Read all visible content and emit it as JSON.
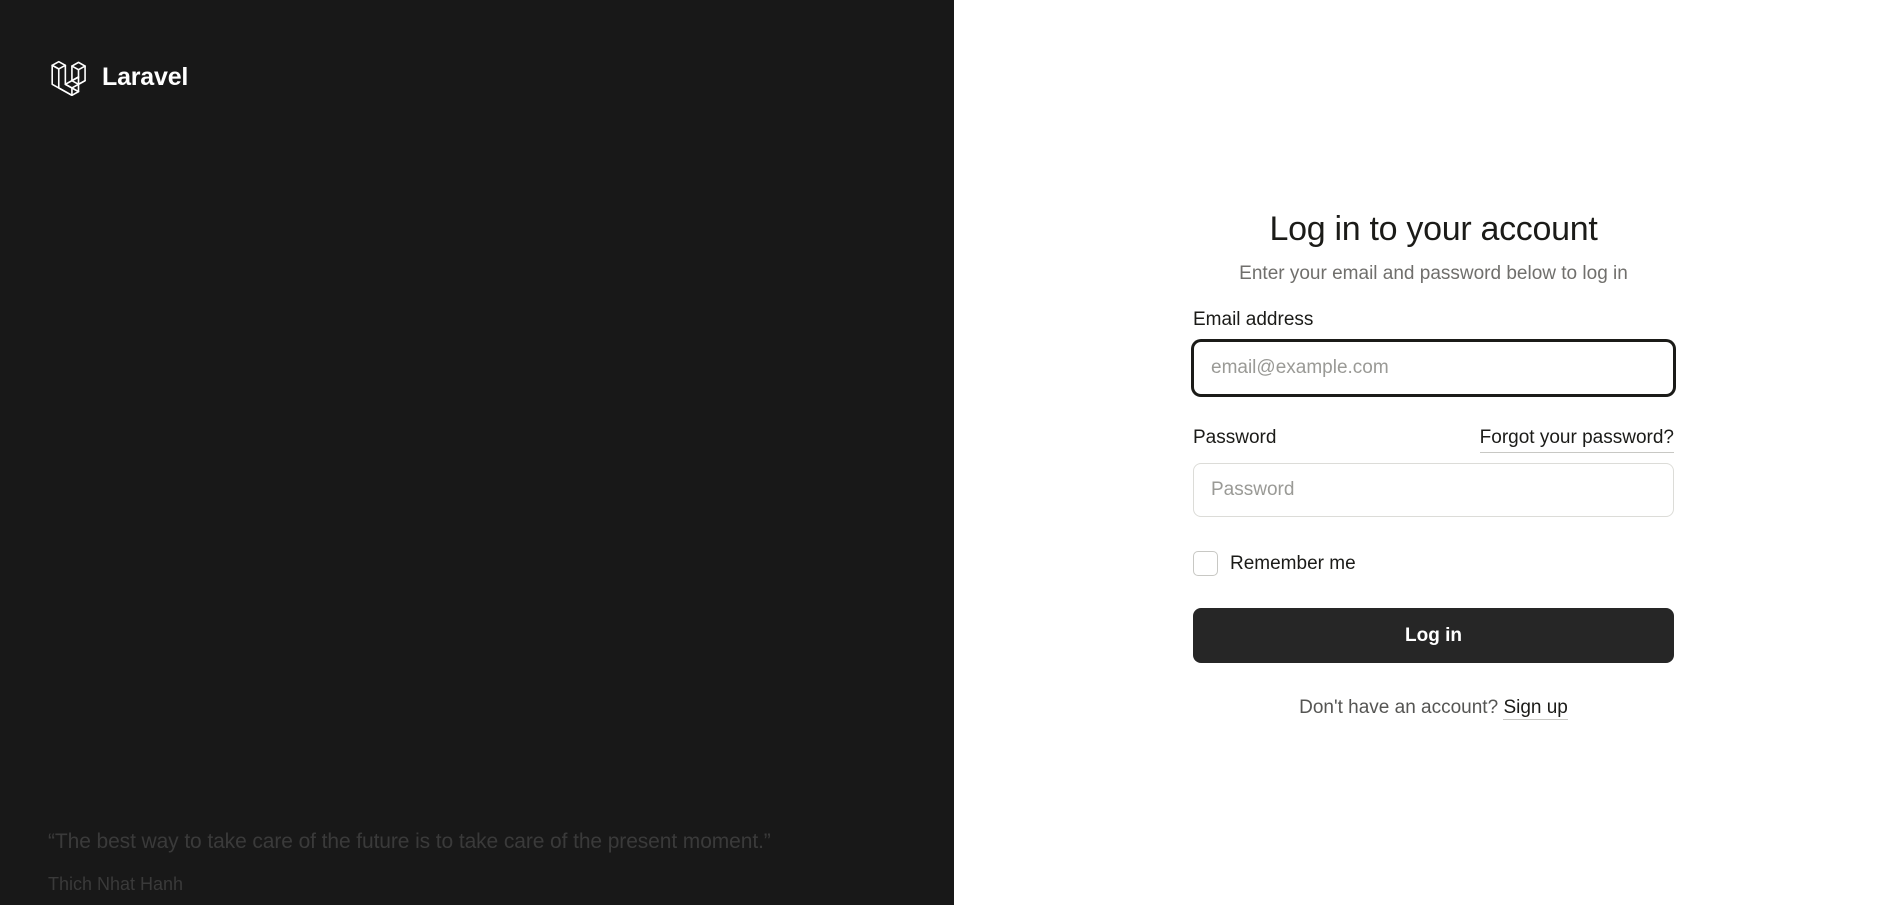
{
  "brand": {
    "name": "Laravel",
    "logo_icon": "laravel-logo-icon"
  },
  "quote": {
    "text": "“The best way to take care of the future is to take care of the present moment.”",
    "author": "Thich Nhat Hanh"
  },
  "form": {
    "title": "Log in to your account",
    "subtitle": "Enter your email and password below to log in",
    "email_label": "Email address",
    "email_value": "",
    "email_placeholder": "email@example.com",
    "password_label": "Password",
    "forgot_link": "Forgot your password?",
    "password_value": "",
    "password_placeholder": "Password",
    "remember_label": "Remember me",
    "remember_checked": false,
    "submit_label": "Log in",
    "signup_prompt": "Don't have an account?",
    "signup_link": "Sign up"
  },
  "colors": {
    "left_panel_bg": "#181818",
    "button_bg": "#262626",
    "text_primary": "#1b1b18",
    "text_muted": "#706f6c"
  }
}
